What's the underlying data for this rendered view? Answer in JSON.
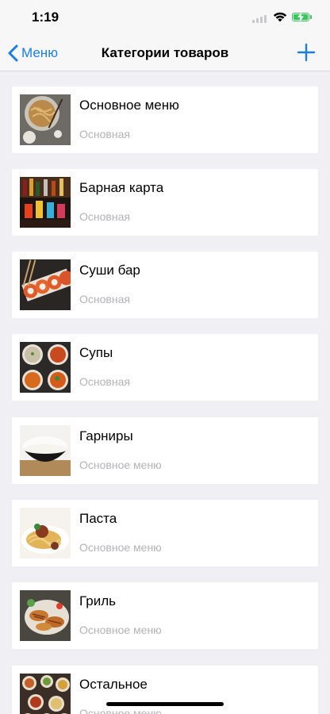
{
  "status_bar": {
    "time": "1:19",
    "battery_color": "#34c759"
  },
  "nav": {
    "back_label": "Меню",
    "title": "Категории товаров",
    "add_icon": "plus-icon",
    "accent": "#1a7ee6"
  },
  "categories": [
    {
      "title": "Основное меню",
      "subtitle": "Основная",
      "image": "noodles-image"
    },
    {
      "title": "Барная карта",
      "subtitle": "Основная",
      "image": "bar-bottles-image"
    },
    {
      "title": "Суши бар",
      "subtitle": "Основная",
      "image": "sushi-image"
    },
    {
      "title": "Супы",
      "subtitle": "Основная",
      "image": "soups-image"
    },
    {
      "title": "Гарниры",
      "subtitle": "Основное меню",
      "image": "rice-bowl-image"
    },
    {
      "title": "Паста",
      "subtitle": "Основное меню",
      "image": "pasta-image"
    },
    {
      "title": "Гриль",
      "subtitle": "Основное меню",
      "image": "grill-image"
    },
    {
      "title": "Остальное",
      "subtitle": "Основное меню",
      "image": "assorted-dishes-image"
    }
  ]
}
